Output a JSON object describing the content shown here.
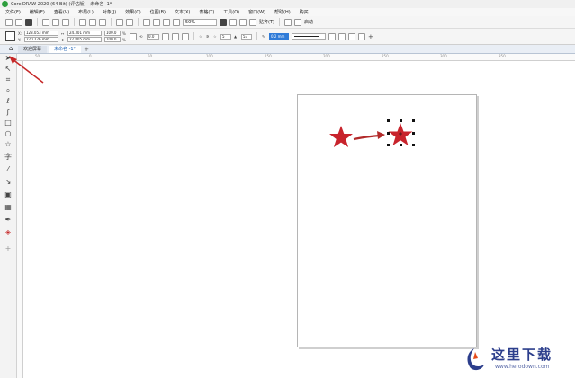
{
  "titlebar": {
    "title": "CorelDRAW 2020 (64-Bit) (评估版) - 未命名 -1*"
  },
  "menu": [
    "文件(F)",
    "编辑(E)",
    "查看(V)",
    "布局(L)",
    "对象(J)",
    "效果(C)",
    "位图(B)",
    "文本(X)",
    "表格(T)",
    "工具(O)",
    "窗口(W)",
    "帮助(H)",
    "购买"
  ],
  "toolbar": {
    "zoom": "50%",
    "snap_label": "贴齐(T)",
    "launch_label": "启动"
  },
  "propertybar": {
    "x": "123.053 mm",
    "y": "220.276 mm",
    "width": "24.301 mm",
    "height": "22.805 mm",
    "scale_x": "100.0",
    "scale_y": "100.0",
    "percent": "%",
    "rotation": "0.0",
    "points": "5",
    "sharpness": "53",
    "outline_width": "0.2 mm"
  },
  "tabs": {
    "welcome": "欢迎屏幕",
    "document": "未命名 -1*"
  },
  "ruler": {
    "marks": [
      "50",
      "0",
      "50",
      "100",
      "150",
      "200",
      "250",
      "300",
      "350"
    ]
  },
  "colors": {
    "star": "#c8232c",
    "arrow": "#b22a2a",
    "active_field": "#2f7bd8",
    "watermark": "#2c3e8c"
  },
  "watermark": {
    "title": "这里下载",
    "url": "www.herodown.com"
  }
}
